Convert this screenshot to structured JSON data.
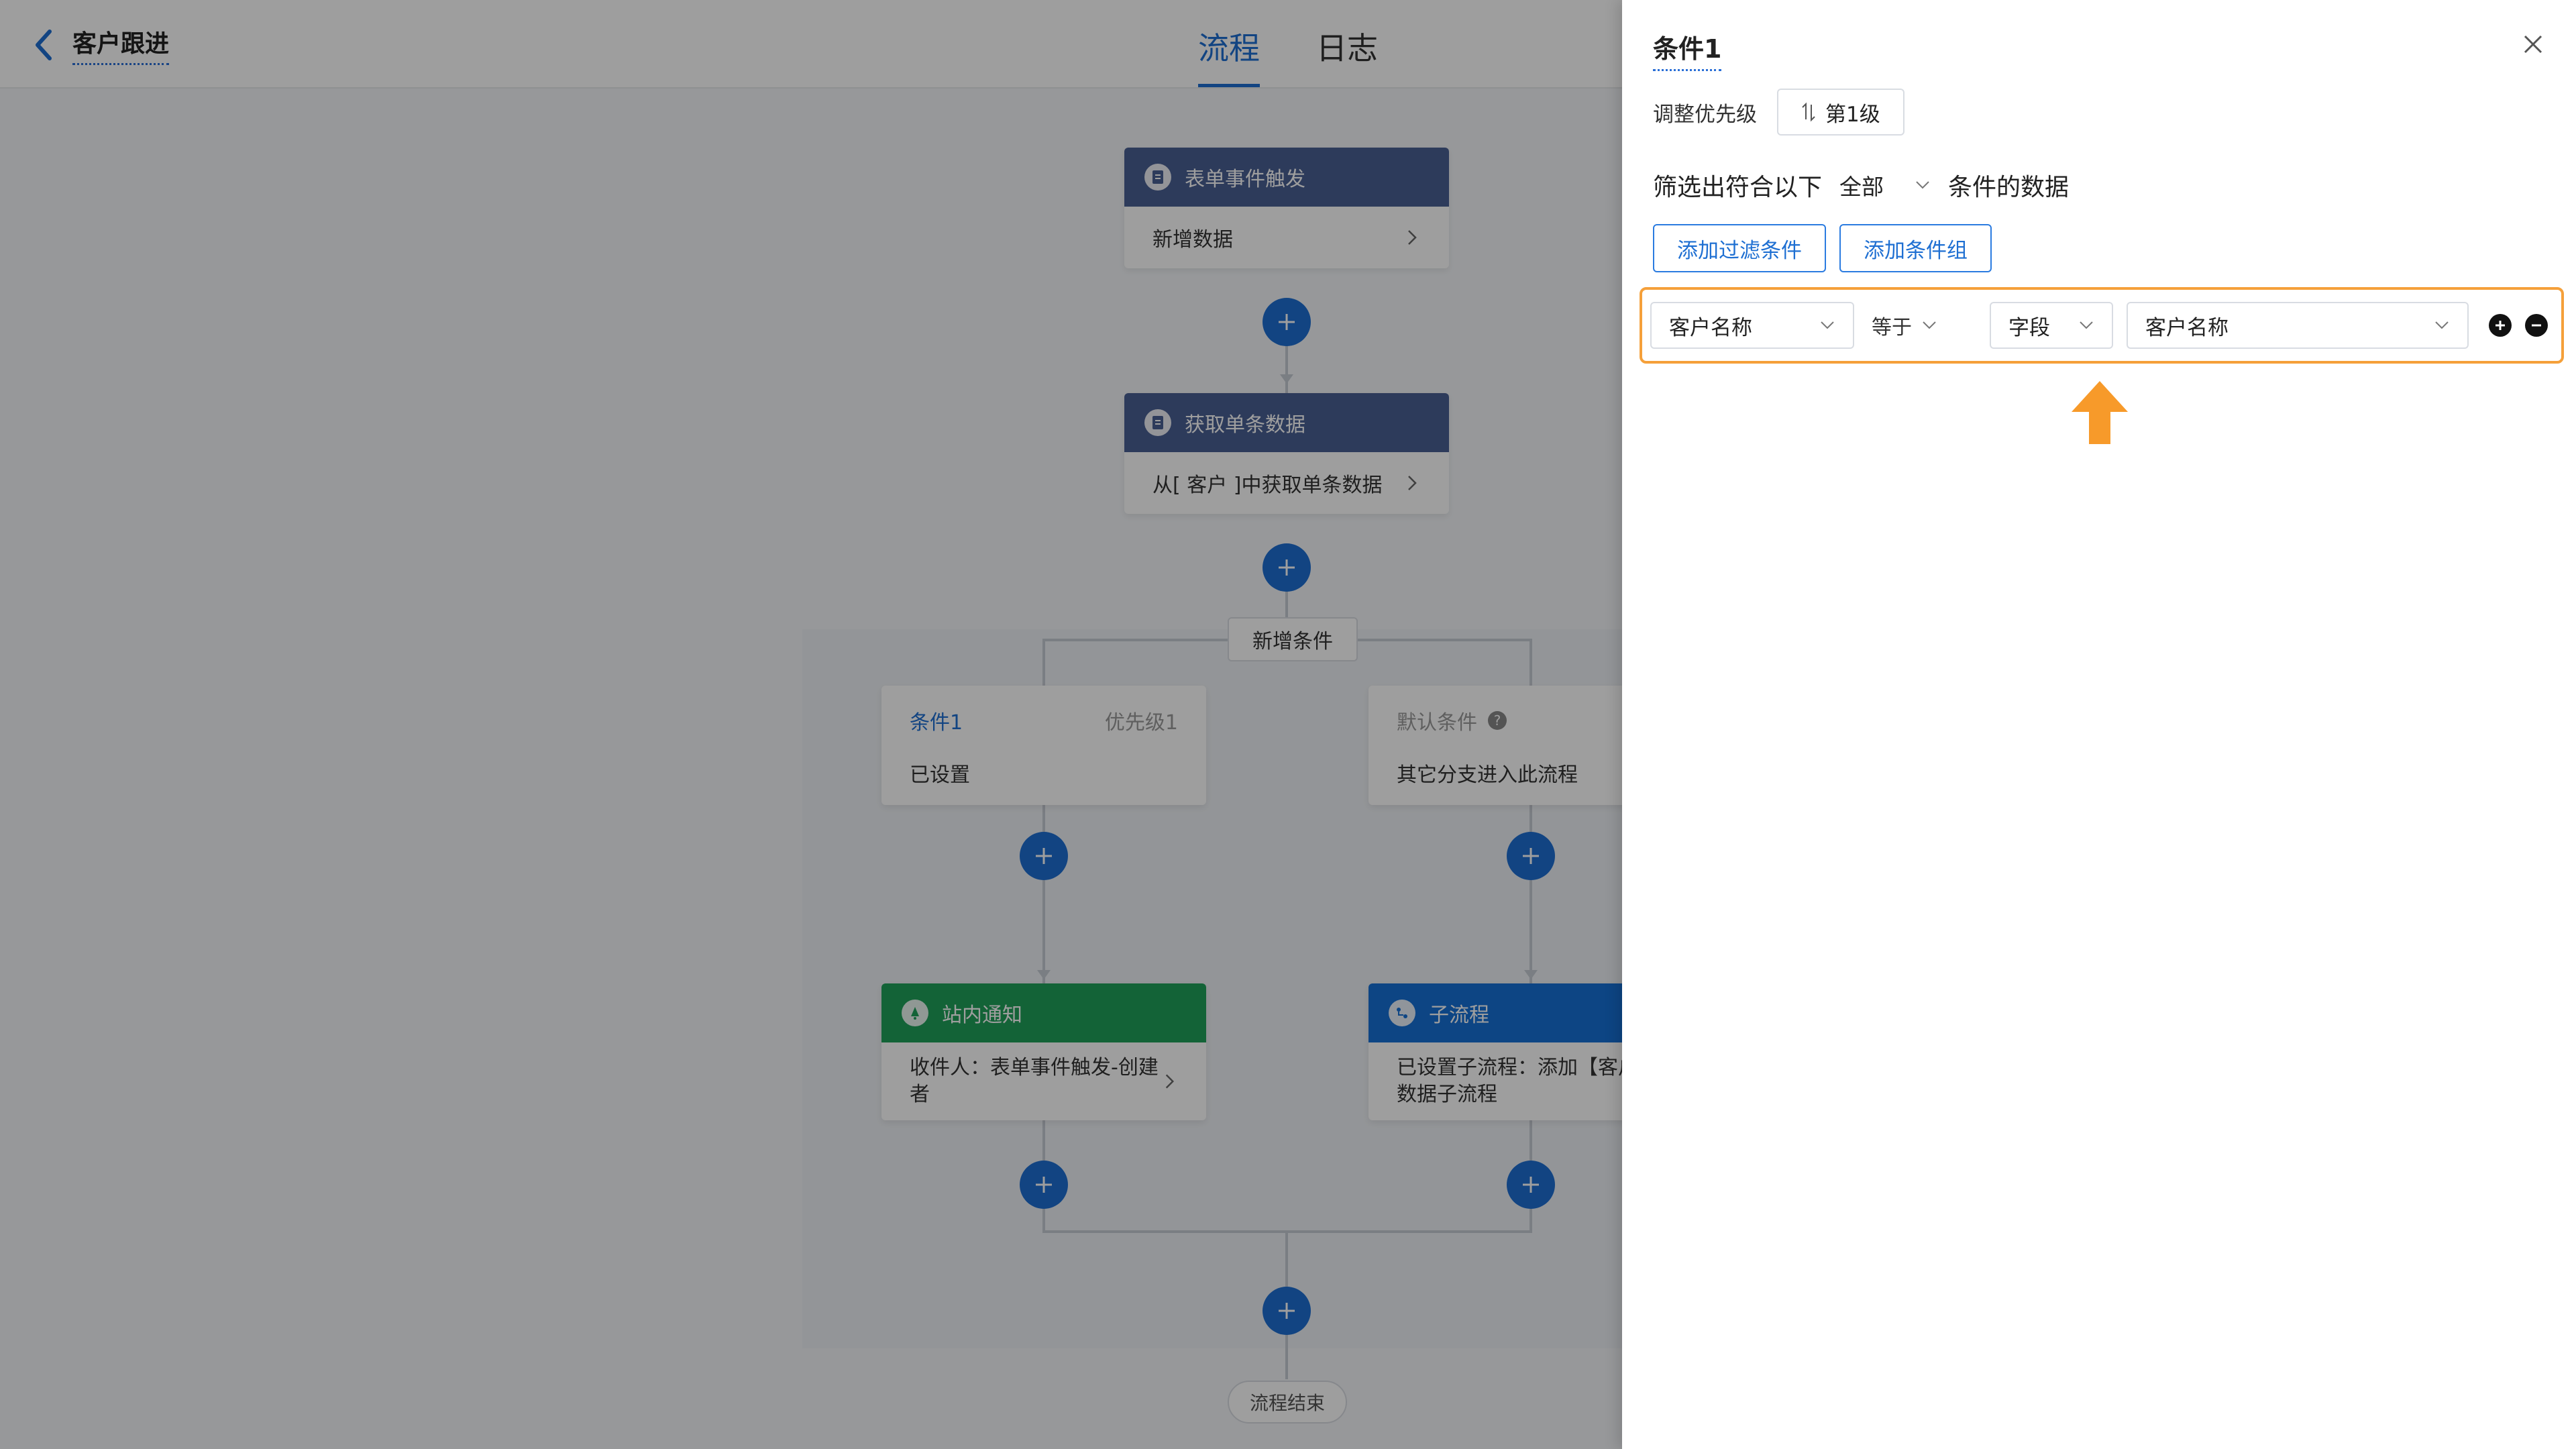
{
  "header": {
    "title": "客户跟进",
    "tabs": [
      {
        "label": "流程",
        "active": true
      },
      {
        "label": "日志",
        "active": false
      }
    ]
  },
  "flow": {
    "trigger": {
      "title": "表单事件触发",
      "desc": "新增数据",
      "color": "#4a5f94"
    },
    "fetch": {
      "title": "获取单条数据",
      "desc": "从[ 客户 ]中获取单条数据",
      "color": "#4a5f94"
    },
    "add_condition_label": "新增条件",
    "branches": [
      {
        "condition": {
          "name": "条件1",
          "priority": "优先级1",
          "desc": "已设置"
        },
        "action": {
          "title": "站内通知",
          "desc": "收件人：表单事件触发-创建者",
          "color": "#1fa15a",
          "icon": "bell-icon"
        }
      },
      {
        "condition": {
          "name": "默认条件",
          "priority": "优",
          "desc": "其它分支进入此流程"
        },
        "action": {
          "title": "子流程",
          "desc": "已设置子流程：添加【客户】数据子流程",
          "color": "#1570d6",
          "icon": "subflow-icon"
        }
      }
    ],
    "end_label": "流程结束"
  },
  "panel": {
    "title": "条件1",
    "priority_label": "调整优先级",
    "priority_value": "第1级",
    "filter_prefix": "筛选出符合以下",
    "filter_scope": "全部",
    "filter_suffix": "条件的数据",
    "add_filter_label": "添加过滤条件",
    "add_group_label": "添加条件组",
    "condition_row": {
      "field": "客户名称",
      "operator": "等于",
      "value_type": "字段",
      "value": "客户名称"
    }
  },
  "colors": {
    "accent": "#1e6fd2",
    "highlight": "#f5a03a"
  }
}
